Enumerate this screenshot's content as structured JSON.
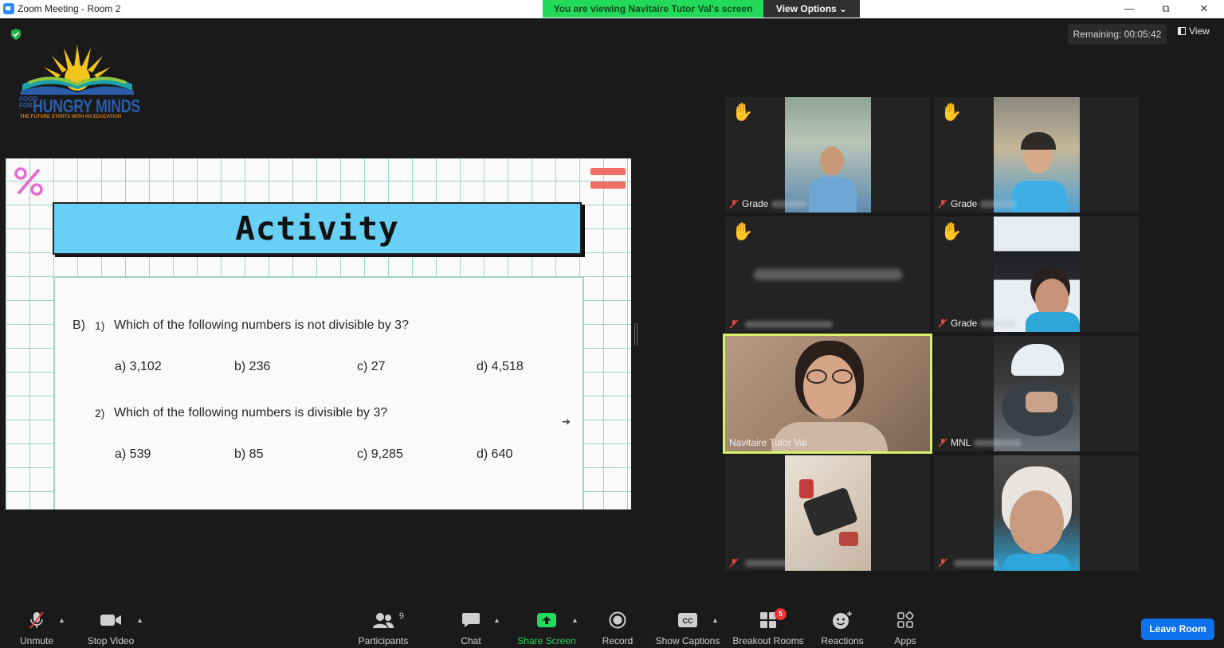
{
  "window": {
    "title": "Zoom Meeting - Room 2",
    "viewing_banner": "You are viewing Navitaire Tutor Val's screen",
    "view_options": "View Options ⌄",
    "minimize": "—",
    "maximize": "⧉",
    "close": "✕"
  },
  "meeting": {
    "remaining": "Remaining: 00:05:42",
    "view_label": "View"
  },
  "logo": {
    "food_for": "FOOD FOR",
    "name": "HUNGRY MINDS",
    "tagline": "THE FUTURE STARTS WITH AN EDUCATION"
  },
  "slide": {
    "title": "Activity",
    "section": "B)",
    "q1": {
      "number": "1)",
      "text": "Which of the following numbers is not divisible by 3?",
      "options": [
        "a)  3,102",
        "b)  236",
        "c)  27",
        "d)  4,518"
      ]
    },
    "q2": {
      "number": "2)",
      "text": "Which of the following numbers is divisible by 3?",
      "options": [
        "a)  539",
        "b)  85",
        "c)  9,285",
        "d)  640"
      ]
    }
  },
  "participants": [
    {
      "name": "Grade",
      "hand_raised": true,
      "muted": true
    },
    {
      "name": "Grade",
      "hand_raised": true,
      "muted": true
    },
    {
      "name": "",
      "hand_raised": true,
      "muted": true
    },
    {
      "name": "Grade",
      "hand_raised": true,
      "muted": true
    },
    {
      "name": "Navitaire Tutor Val",
      "hand_raised": false,
      "muted": false,
      "active_speaker": true
    },
    {
      "name": "MNL",
      "hand_raised": false,
      "muted": true
    },
    {
      "name": "",
      "hand_raised": false,
      "muted": true
    },
    {
      "name": "",
      "hand_raised": false,
      "muted": true
    }
  ],
  "toolbar": {
    "unmute": "Unmute",
    "stop_video": "Stop Video",
    "participants": "Participants",
    "participants_count": "9",
    "chat": "Chat",
    "share_screen": "Share Screen",
    "record": "Record",
    "show_captions": "Show Captions",
    "breakout_rooms": "Breakout Rooms",
    "breakout_badge": "5",
    "reactions": "Reactions",
    "apps": "Apps",
    "leave_room": "Leave Room"
  },
  "colors": {
    "share_green": "#23d959",
    "leave_blue": "#0e72ed",
    "active_speaker_border": "#d7f36a",
    "banner_blue": "#67d0f4",
    "hand_yellow": "#f5b83a"
  }
}
